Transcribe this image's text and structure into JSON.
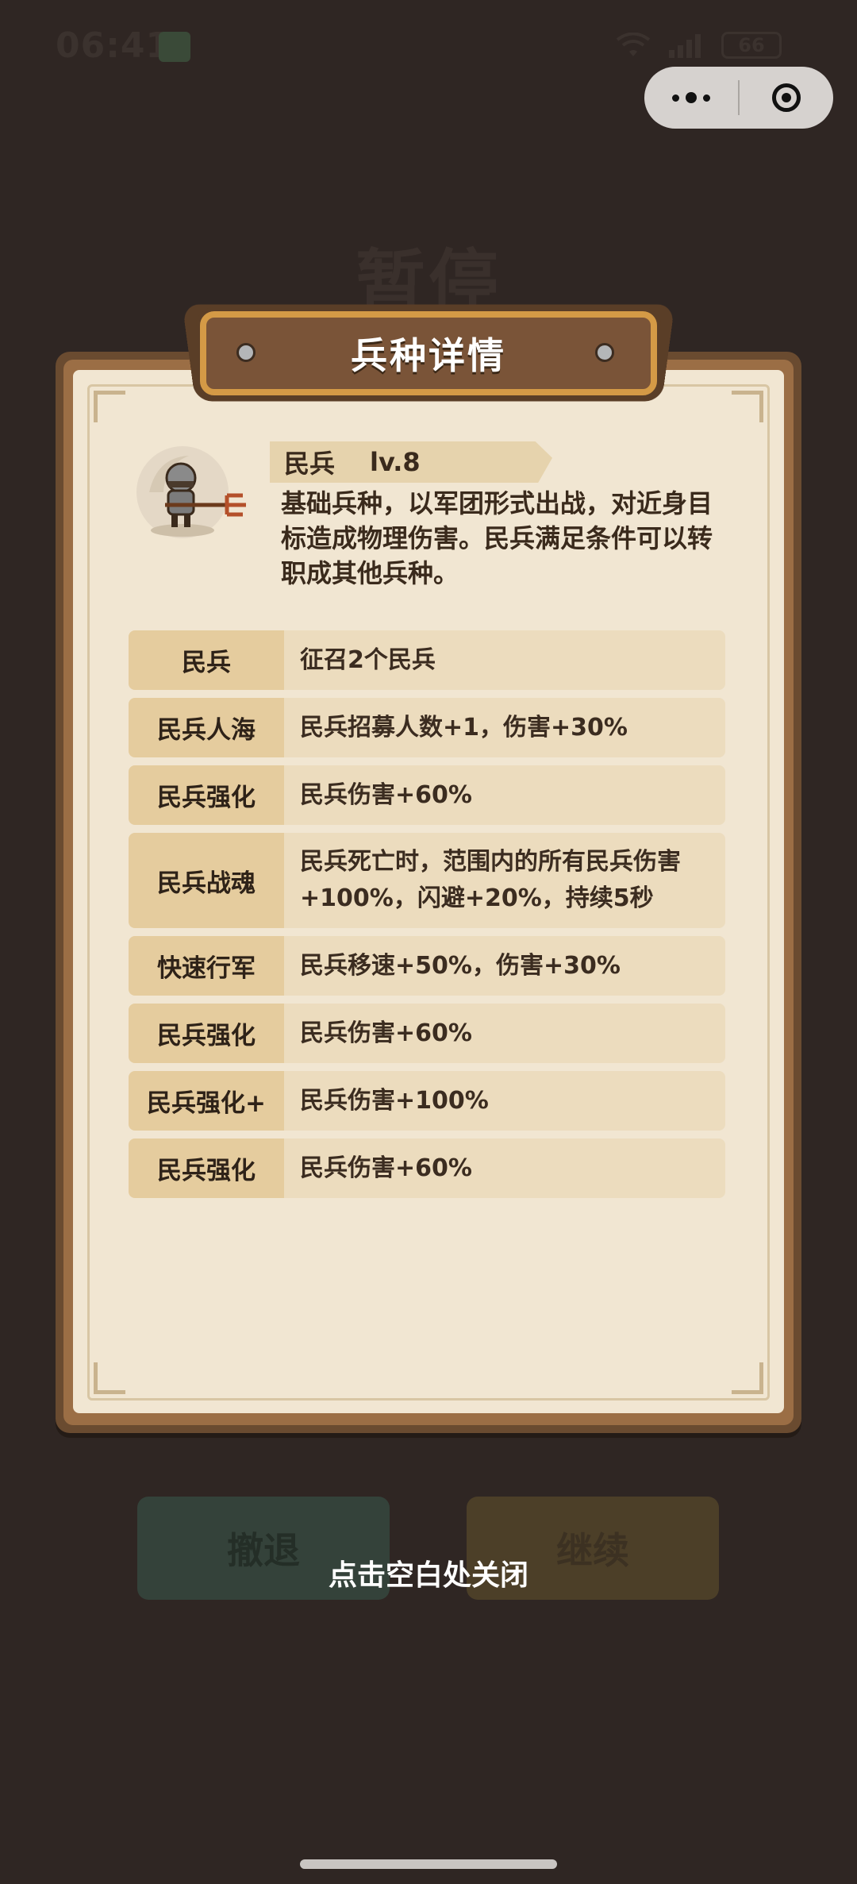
{
  "status_bar": {
    "time": "06:41",
    "battery": "66"
  },
  "background": {
    "title": "暂停",
    "retreat_label": "撤退",
    "continue_label": "继续"
  },
  "dialog": {
    "title": "兵种详情",
    "unit": {
      "name": "民兵",
      "level": "lv.8",
      "description": "基础兵种，以军团形式出战，对近身目标造成物理伤害。民兵满足条件可以转职成其他兵种。"
    },
    "skills": [
      {
        "name": "民兵",
        "effect": "征召2个民兵"
      },
      {
        "name": "民兵人海",
        "effect": "民兵招募人数+1，伤害+30%"
      },
      {
        "name": "民兵强化",
        "effect": "民兵伤害+60%"
      },
      {
        "name": "民兵战魂",
        "effect": "民兵死亡时，范围内的所有民兵伤害+100%，闪避+20%，持续5秒"
      },
      {
        "name": "快速行军",
        "effect": "民兵移速+50%，伤害+30%"
      },
      {
        "name": "民兵强化",
        "effect": "民兵伤害+60%"
      },
      {
        "name": "民兵强化+",
        "effect": "民兵伤害+100%"
      },
      {
        "name": "民兵强化",
        "effect": "民兵伤害+60%"
      }
    ]
  },
  "close_hint": "点击空白处关闭",
  "icons": {
    "menu": "more-dots-icon",
    "close": "target-close-icon",
    "wifi": "wifi-icon",
    "signal": "signal-icon",
    "battery": "battery-icon",
    "avatar": "militia-soldier-icon"
  }
}
